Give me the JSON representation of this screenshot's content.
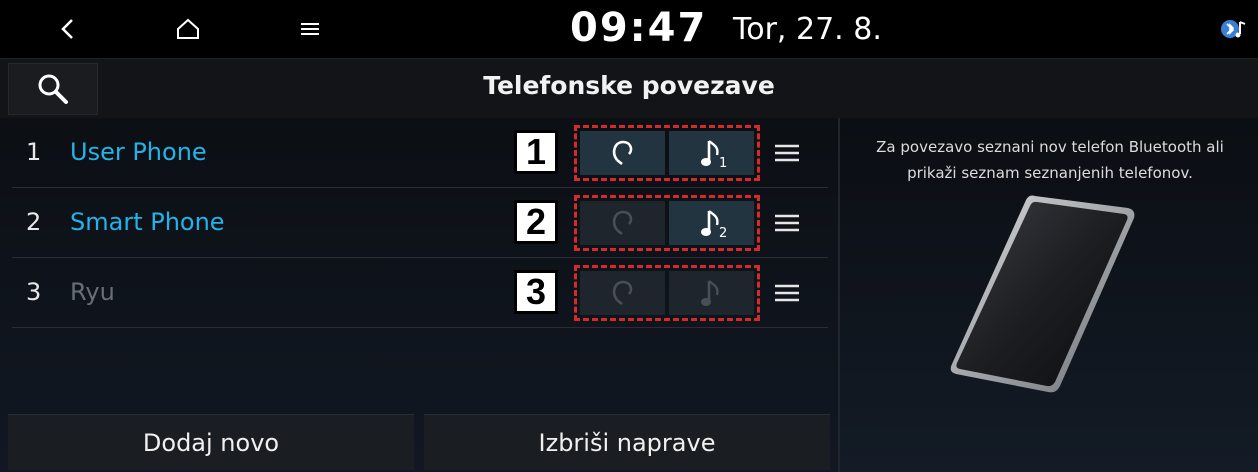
{
  "status": {
    "time": "09:47",
    "date": "Tor, 27. 8."
  },
  "icons": {
    "back": "chevron-left-icon",
    "home": "home-icon",
    "menu": "hamburger-icon",
    "bluetooth": "bluetooth-audio-icon",
    "search": "search-icon"
  },
  "title": "Telefonske povezave",
  "devices": [
    {
      "index": "1",
      "name": "User Phone",
      "connected": true,
      "call_active": true,
      "audio_active": true,
      "audio_sub": "1",
      "callout": "1"
    },
    {
      "index": "2",
      "name": "Smart Phone",
      "connected": true,
      "call_active": false,
      "audio_active": true,
      "audio_sub": "2",
      "callout": "2"
    },
    {
      "index": "3",
      "name": "Ryu",
      "connected": false,
      "call_active": false,
      "audio_active": false,
      "audio_sub": "",
      "callout": "3"
    }
  ],
  "buttons": {
    "add_new": "Dodaj novo",
    "delete_devices": "Izbriši naprave"
  },
  "side_panel": {
    "line1": "Za povezavo seznani nov telefon Bluetooth ali",
    "line2": "prikaži seznam seznanjenih telefonov."
  },
  "colors": {
    "accent": "#22b4e8",
    "inactive": "#6b6e73",
    "callout_border": "#d42a2a"
  }
}
